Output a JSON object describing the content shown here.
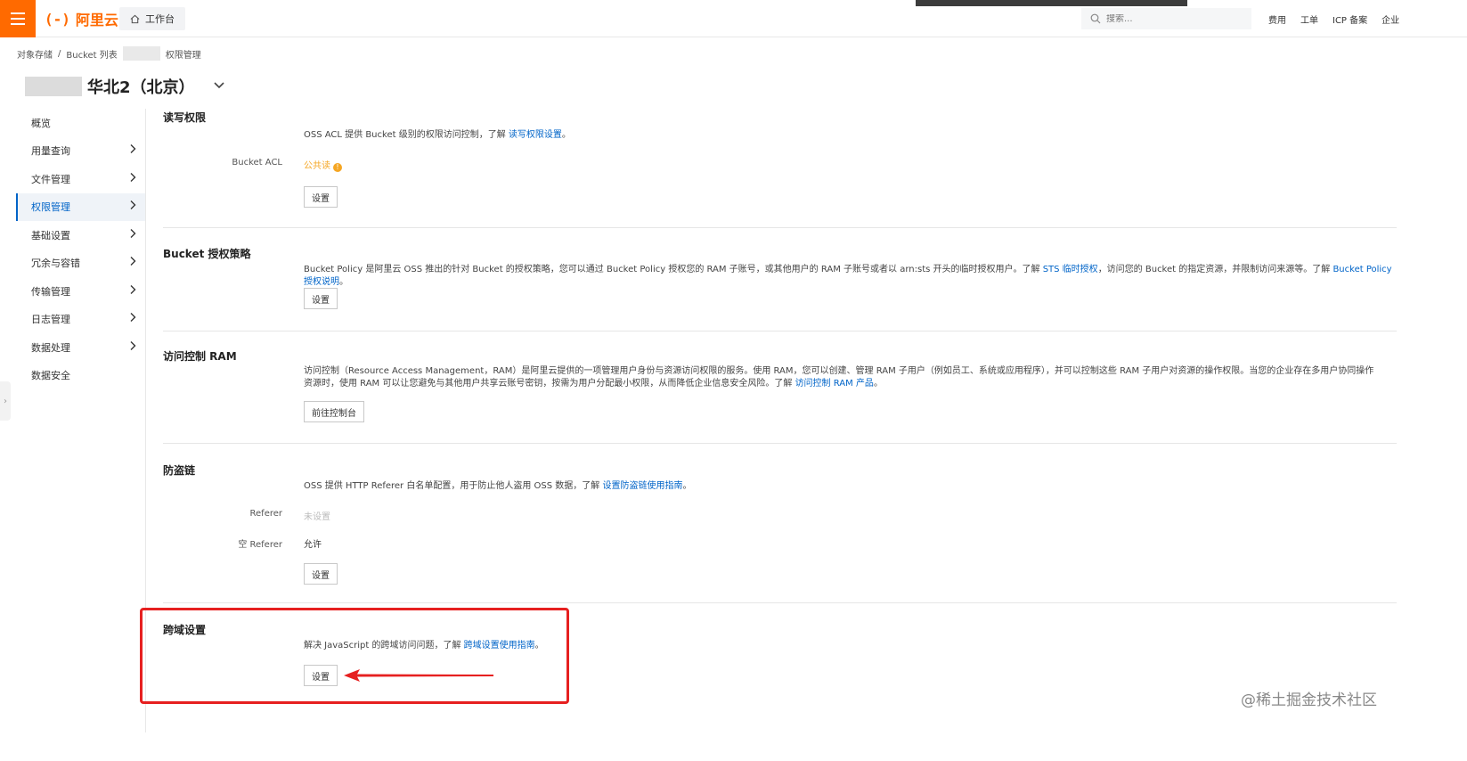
{
  "topbar": {
    "logo_text": "阿里云",
    "logo_mark": "(-)",
    "workbench": "工作台",
    "search_placeholder": "搜索...",
    "links": [
      "费用",
      "工单",
      "ICP 备案",
      "企业"
    ],
    "brand_color": "#ff6a00"
  },
  "breadcrumb": {
    "items": [
      "对象存储",
      "Bucket 列表",
      "权限管理"
    ],
    "sep": "/"
  },
  "bucket": {
    "region": "华北2（北京）"
  },
  "sidebar": {
    "items": [
      {
        "label": "概览",
        "has_arrow": false
      },
      {
        "label": "用量查询",
        "has_arrow": true
      },
      {
        "label": "文件管理",
        "has_arrow": true
      },
      {
        "label": "权限管理",
        "has_arrow": true,
        "active": true
      },
      {
        "label": "基础设置",
        "has_arrow": true
      },
      {
        "label": "冗余与容错",
        "has_arrow": true
      },
      {
        "label": "传输管理",
        "has_arrow": true
      },
      {
        "label": "日志管理",
        "has_arrow": true
      },
      {
        "label": "数据处理",
        "has_arrow": true
      },
      {
        "label": "数据安全",
        "has_arrow": false
      }
    ]
  },
  "acl": {
    "title": "读写权限",
    "desc": "OSS ACL 提供 Bucket 级别的权限访问控制，了解 ",
    "link": "读写权限设置",
    "desc_end": "。",
    "field_label": "Bucket ACL",
    "field_value": "公共读",
    "button": "设置"
  },
  "policy": {
    "title": "Bucket 授权策略",
    "desc_1": "Bucket Policy 是阿里云 OSS 推出的针对 Bucket 的授权策略，您可以通过 Bucket Policy 授权您的 RAM 子账号，或其他用户的 RAM 子账号或者以 arn:sts 开头的临时授权用户。了解 ",
    "link_1": "STS 临时授权",
    "desc_2": "，访问您的 Bucket 的指定资源，并限制访问来源等。了解 ",
    "link_2": "Bucket Policy 授权说明",
    "desc_end": "。",
    "button": "设置"
  },
  "ram": {
    "title": "访问控制 RAM",
    "desc": "访问控制（Resource Access Management，RAM）是阿里云提供的一项管理用户身份与资源访问权限的服务。使用 RAM，您可以创建、管理 RAM 子用户（例如员工、系统或应用程序），并可以控制这些 RAM 子用户对资源的操作权限。当您的企业存在多用户协同操作资源时，使用 RAM 可以让您避免与其他用户共享云账号密钥，按需为用户分配最小权限，从而降低企业信息安全风险。了解 ",
    "link": "访问控制 RAM 产品",
    "desc_end": "。",
    "button": "前往控制台"
  },
  "referer": {
    "title": "防盗链",
    "desc": "OSS 提供 HTTP Referer 白名单配置，用于防止他人盗用 OSS 数据，了解 ",
    "link": "设置防盗链使用指南",
    "desc_end": "。",
    "referer_label": "Referer",
    "referer_value": "未设置",
    "empty_label": "空 Referer",
    "empty_value": "允许",
    "button": "设置"
  },
  "cors": {
    "title": "跨域设置",
    "desc": "解决 JavaScript 的跨域访问问题，了解 ",
    "link": "跨域设置使用指南",
    "desc_end": "。",
    "button": "设置"
  },
  "watermark": "@稀土掘金技术社区",
  "colors": {
    "link": "#0064c8",
    "warning": "#f5a623",
    "highlight": "#e62020"
  }
}
